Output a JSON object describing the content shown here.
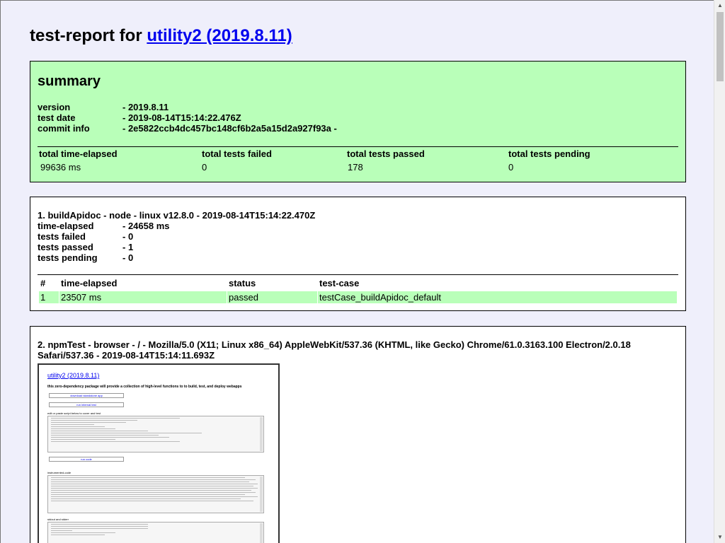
{
  "title": {
    "prefix": "test-report for",
    "link": "utility2 (2019.8.11)"
  },
  "summary": {
    "heading": "summary",
    "fields": [
      {
        "key": "version",
        "value": "- 2019.8.11"
      },
      {
        "key": "test date",
        "value": "- 2019-08-14T15:14:22.476Z"
      },
      {
        "key": "commit info",
        "value": "- 2e5822ccb4dc457bc148cf6b2a5a15d2a927f93a -"
      }
    ],
    "stats_headers": [
      "total time-elapsed",
      "total tests failed",
      "total tests passed",
      "total tests pending"
    ],
    "stats_values": [
      "99636 ms",
      "0",
      "178",
      "0"
    ]
  },
  "testcase1": {
    "title": "1. buildApidoc - node - linux v12.8.0 - 2019-08-14T15:14:22.470Z",
    "fields": [
      {
        "key": "time-elapsed",
        "value": "- 24658 ms"
      },
      {
        "key": "tests failed",
        "value": "- 0"
      },
      {
        "key": "tests passed",
        "value": "- 1"
      },
      {
        "key": "tests pending",
        "value": "- 0"
      }
    ],
    "headers": [
      "#",
      "time-elapsed",
      "status",
      "test-case"
    ],
    "rows": [
      [
        "1",
        "23507 ms",
        "passed",
        "testCase_buildApidoc_default"
      ]
    ]
  },
  "testcase2": {
    "title": "2. npmTest - browser - / - Mozilla/5.0 (X11; Linux x86_64) AppleWebKit/537.36 (KHTML, like Gecko) Chrome/61.0.3163.100 Electron/2.0.18 Safari/537.36 - 2019-08-14T15:14:11.693Z",
    "screenshot": {
      "title": "utility2 (2019.8.11)",
      "description": "this zero-dependency package will provide a collection of high-level functions to to build, test, and deploy webapps",
      "button1": "download standalone app",
      "button2": "run internal test",
      "label1": "edit or paste script below to cover and test",
      "button3": "run code",
      "label2": "instrumented-code",
      "label3": "stdout and stderr"
    }
  },
  "colors": {
    "background": "#efeffb",
    "passed": "#b9ffb9",
    "link": "#0000ee"
  }
}
